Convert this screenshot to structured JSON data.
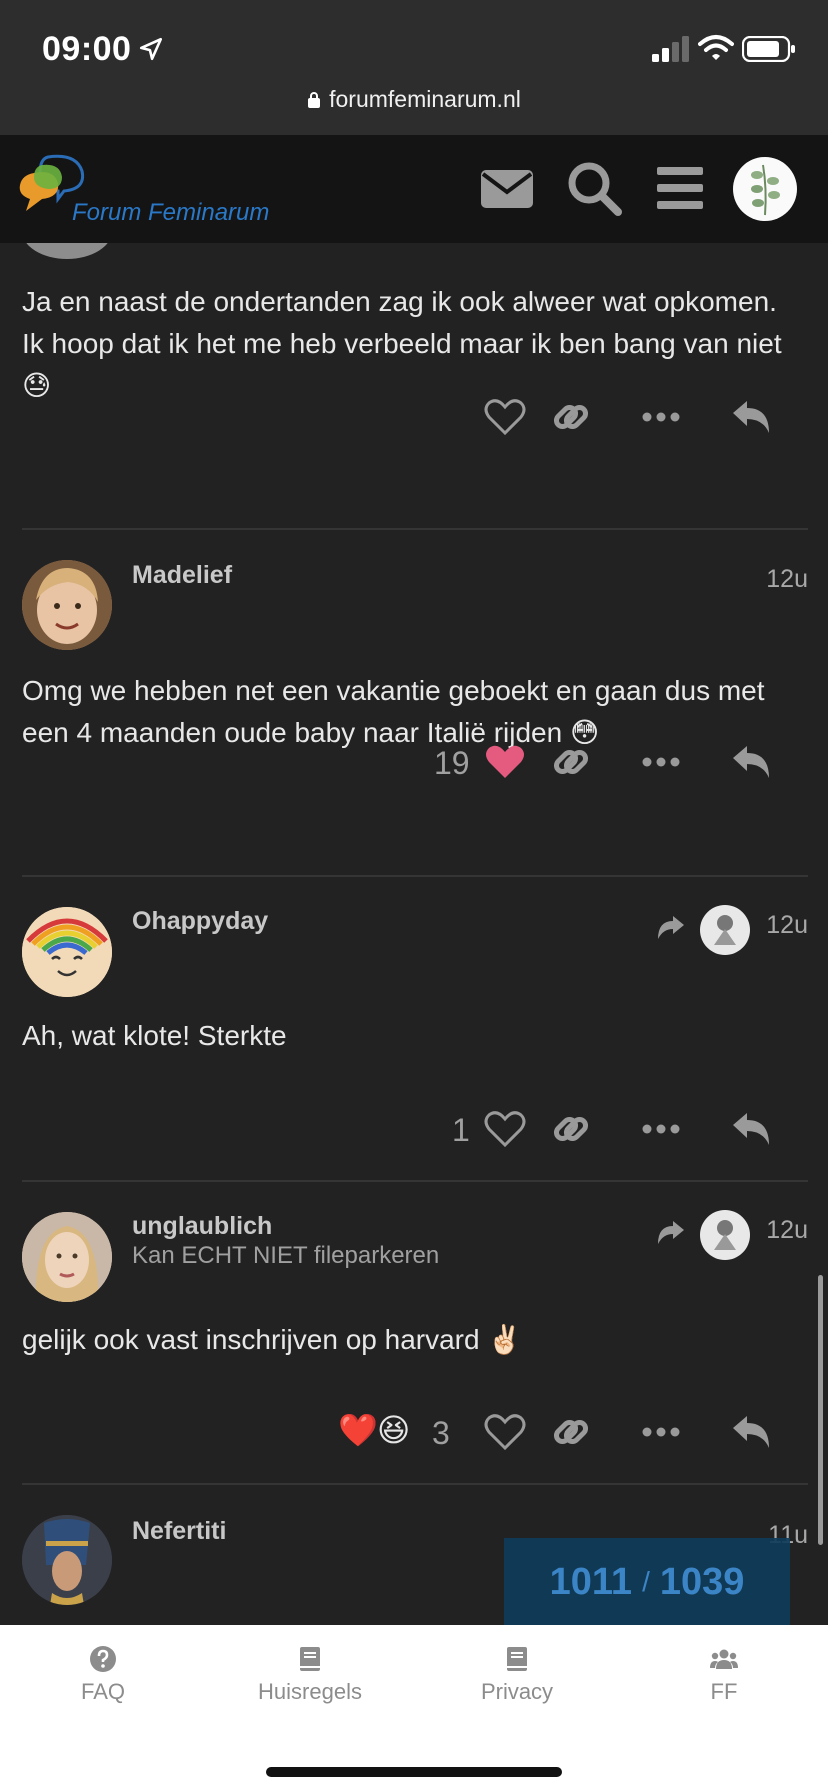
{
  "status_bar": {
    "time": "09:00",
    "url": "forumfeminarum.nl"
  },
  "header": {
    "logo_text": "Forum Feminarum"
  },
  "posts": [
    {
      "body": "Ja en naast de ondertanden zag ik ook alweer wat opkomen. Ik hoop dat ik het me heb verbeeld maar ik ben bang van niet 😓",
      "likes": ""
    },
    {
      "username": "Madelief",
      "time": "12u",
      "body": "Omg we hebben net een vakantie geboekt en gaan dus met een 4 maanden oude baby naar Italië rijden 😳",
      "likes": "19",
      "liked": true
    },
    {
      "username": "Ohappyday",
      "time": "12u",
      "body": "Ah, wat klote! Sterkte",
      "likes": "1"
    },
    {
      "username": "unglaublich",
      "user_title": "Kan ECHT NIET fileparkeren",
      "time": "12u",
      "body": "gelijk ook vast inschrijven op harvard ✌🏻",
      "reactions": [
        "❤️",
        "😆"
      ],
      "likes": "3"
    },
    {
      "username": "Nefertiti",
      "time": "11u"
    }
  ],
  "timeline": {
    "current": "1011",
    "separator": "/",
    "total": "1039"
  },
  "footer": {
    "items": [
      {
        "label": "FAQ",
        "icon": "question-circle-icon"
      },
      {
        "label": "Huisregels",
        "icon": "book-icon"
      },
      {
        "label": "Privacy",
        "icon": "book-icon"
      },
      {
        "label": "FF",
        "icon": "users-icon"
      }
    ]
  },
  "colors": {
    "background": "#222222",
    "header": "#141414",
    "accent": "#3e8ed6",
    "heart": "#e45b7f"
  }
}
